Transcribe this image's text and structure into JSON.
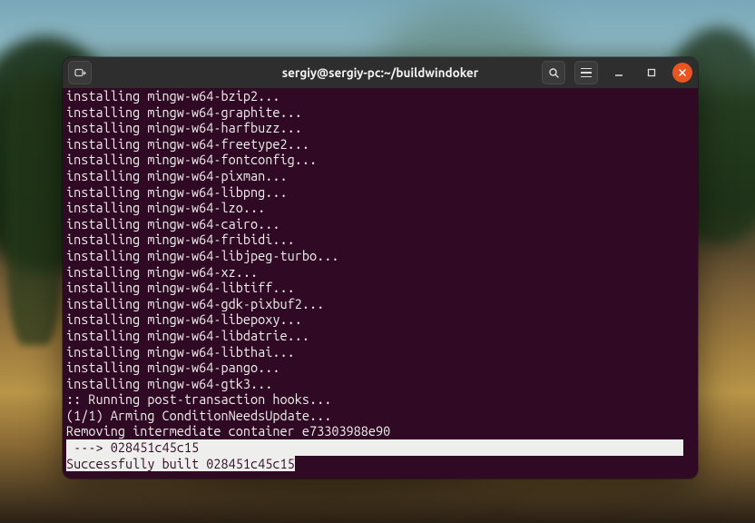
{
  "titlebar": {
    "title": "sergiy@sergiy-pc:~/buildwindoker"
  },
  "terminal": {
    "lines": [
      {
        "text": "installing mingw-w64-bzip2...",
        "style": ""
      },
      {
        "text": "installing mingw-w64-graphite...",
        "style": ""
      },
      {
        "text": "installing mingw-w64-harfbuzz...",
        "style": ""
      },
      {
        "text": "installing mingw-w64-freetype2...",
        "style": ""
      },
      {
        "text": "installing mingw-w64-fontconfig...",
        "style": ""
      },
      {
        "text": "installing mingw-w64-pixman...",
        "style": ""
      },
      {
        "text": "installing mingw-w64-libpng...",
        "style": ""
      },
      {
        "text": "installing mingw-w64-lzo...",
        "style": ""
      },
      {
        "text": "installing mingw-w64-cairo...",
        "style": ""
      },
      {
        "text": "installing mingw-w64-fribidi...",
        "style": ""
      },
      {
        "text": "installing mingw-w64-libjpeg-turbo...",
        "style": ""
      },
      {
        "text": "installing mingw-w64-xz...",
        "style": ""
      },
      {
        "text": "installing mingw-w64-libtiff...",
        "style": ""
      },
      {
        "text": "installing mingw-w64-gdk-pixbuf2...",
        "style": ""
      },
      {
        "text": "installing mingw-w64-libepoxy...",
        "style": ""
      },
      {
        "text": "installing mingw-w64-libdatrie...",
        "style": ""
      },
      {
        "text": "installing mingw-w64-libthai...",
        "style": ""
      },
      {
        "text": "installing mingw-w64-pango...",
        "style": ""
      },
      {
        "text": "installing mingw-w64-gtk3...",
        "style": ""
      },
      {
        "text": ":: Running post-transaction hooks...",
        "style": ""
      },
      {
        "text": "(1/1) Arming ConditionNeedsUpdate...",
        "style": ""
      },
      {
        "text": "Removing intermediate container e73303988e90",
        "style": ""
      },
      {
        "text": " ---> 028451c45c15",
        "style": "highlight"
      },
      {
        "text": "Successfully built 028451c45c15",
        "style": "success"
      }
    ]
  }
}
